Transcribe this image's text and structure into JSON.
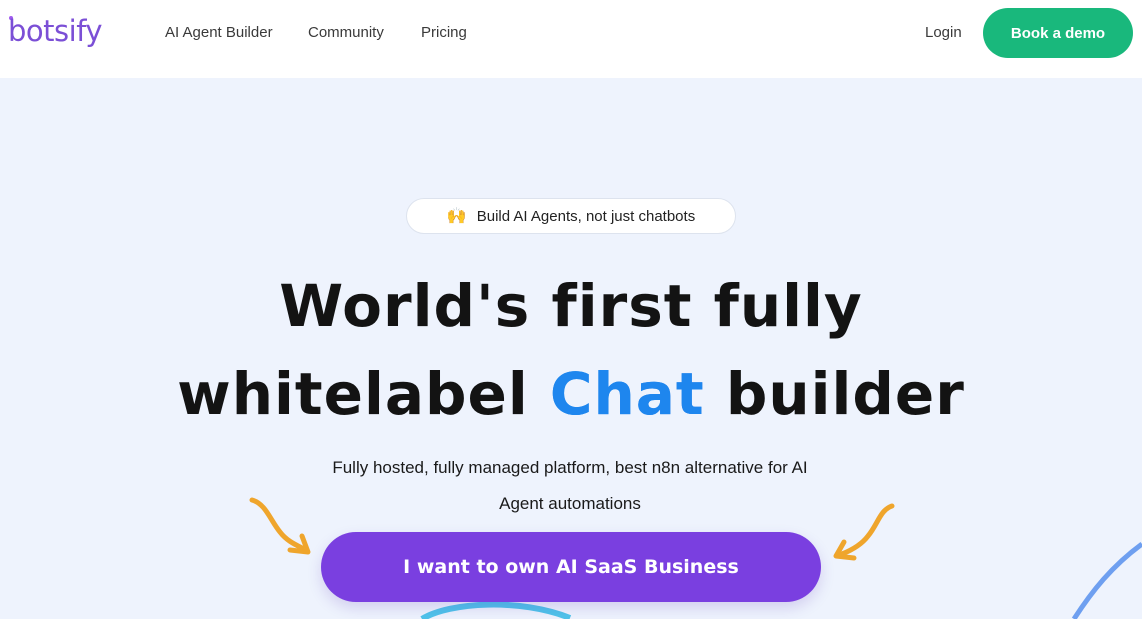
{
  "brand": {
    "name": "botsify",
    "color": "#7b4fd6"
  },
  "nav": {
    "links": [
      "AI Agent Builder",
      "Community",
      "Pricing"
    ],
    "login": "Login",
    "demo_button": "Book a demo"
  },
  "hero": {
    "badge": {
      "icon": "raised-hands-icon",
      "glyph": "🙌",
      "text": "Build AI Agents, not just chatbots"
    },
    "headline": {
      "line1": "World's first fully",
      "line2_before": "whitelabel ",
      "line2_accent": "Chat",
      "line2_after": " builder"
    },
    "subtext_line1": "Fully hosted, fully managed platform, best n8n alternative for AI",
    "subtext_line2": "Agent automations",
    "cta": "I want to own AI SaaS Business"
  },
  "colors": {
    "background": "#eef3fd",
    "demo_button": "#19b87c",
    "cta_button": "#7a3fe0",
    "accent_text": "#1e86ee",
    "arrow": "#efa52c"
  }
}
